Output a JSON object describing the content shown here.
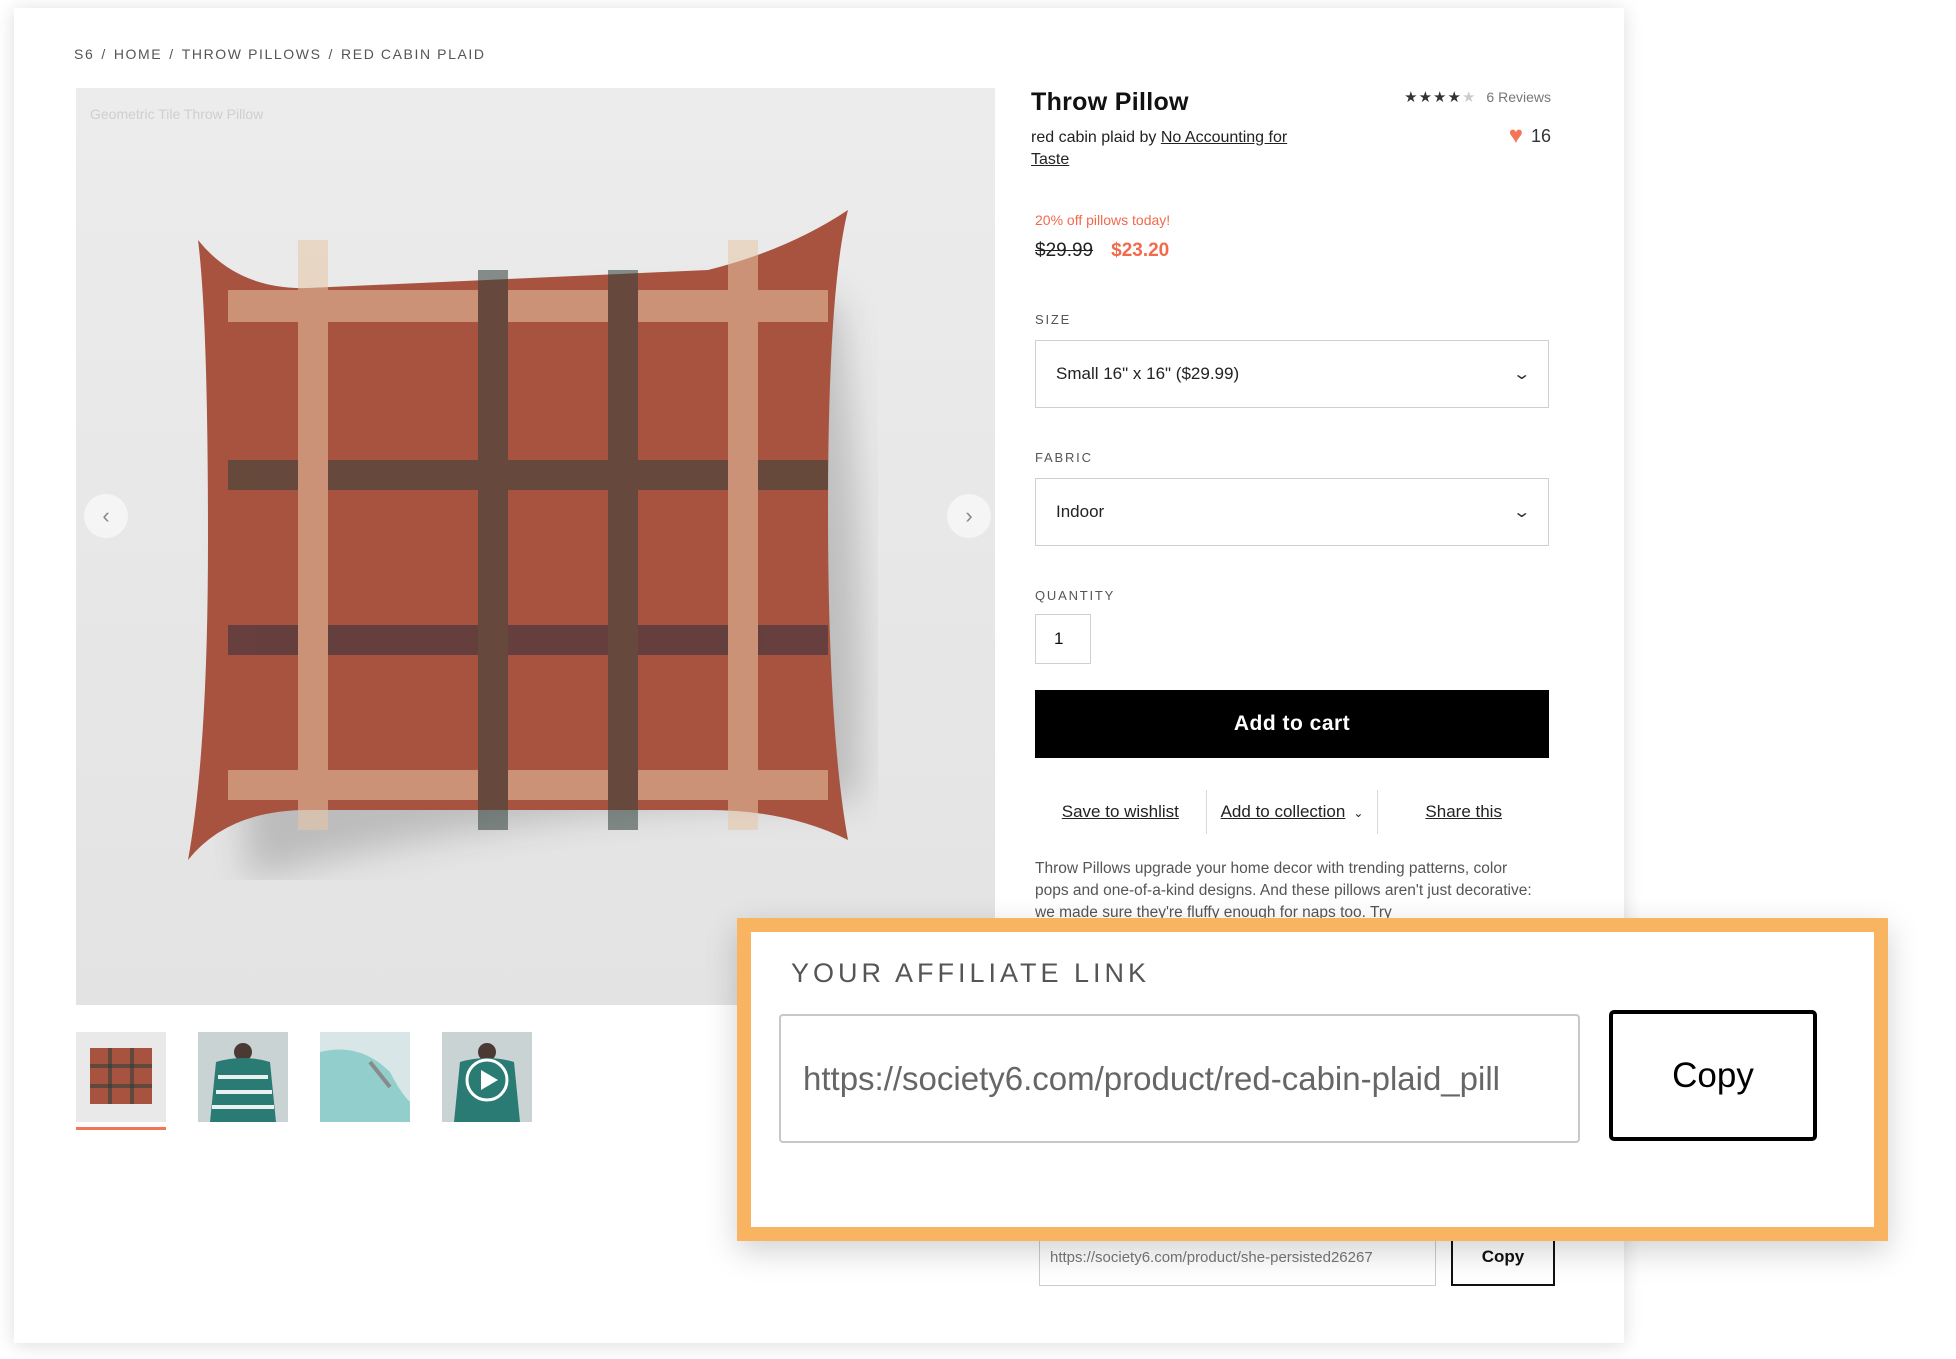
{
  "breadcrumb": [
    "S6",
    "Home",
    "Throw Pillows",
    "Red Cabin Plaid"
  ],
  "image": {
    "caption": "Geometric Tile Throw Pillow",
    "prev_icon": "chevron-left-icon",
    "next_icon": "chevron-right-icon",
    "prev_glyph": "‹",
    "next_glyph": "›"
  },
  "thumbnails": [
    {
      "name": "pillow-thumb",
      "active": true
    },
    {
      "name": "person-blanket-thumb",
      "active": false
    },
    {
      "name": "blue-fabric-thumb",
      "active": false
    },
    {
      "name": "video-thumb",
      "active": false
    }
  ],
  "product": {
    "title": "Throw Pillow",
    "by_prefix": "red cabin plaid by",
    "artist": "No Accounting for Taste",
    "stars_filled": "★★★★",
    "stars_empty": "★",
    "reviews": "6 Reviews",
    "heart_glyph": "♥",
    "likes": "16",
    "promo": "20% off pillows today!",
    "old_price": "$29.99",
    "new_price": "$23.20"
  },
  "options": {
    "size_label": "SIZE",
    "size_value": "Small 16\" x 16\" ($29.99)",
    "fabric_label": "FABRIC",
    "fabric_value": "Indoor",
    "quantity_label": "QUANTITY",
    "quantity_value": "1",
    "chevron_glyph": "⌄"
  },
  "actions": {
    "add_to_cart": "Add to cart",
    "save_to_wishlist": "Save to wishlist",
    "add_to_collection": "Add to collection",
    "share_this": "Share this",
    "small_chevron": "⌄"
  },
  "description": "Throw Pillows upgrade your home decor with trending patterns, color pops and one-of-a-kind designs. And these pillows aren't just decorative: we made sure they're fluffy enough for naps too. Try",
  "background_link": {
    "url": "https://society6.com/product/she-persisted26267",
    "copy_label": "Copy"
  },
  "affiliate": {
    "title": "Your Affiliate Link",
    "url": "https://society6.com/product/red-cabin-plaid_pill",
    "copy_label": "Copy",
    "border_color": "#f9b462"
  },
  "colors": {
    "accent": "#f26a4b",
    "heart": "#f47456",
    "pillow_base": "#a8533f"
  }
}
